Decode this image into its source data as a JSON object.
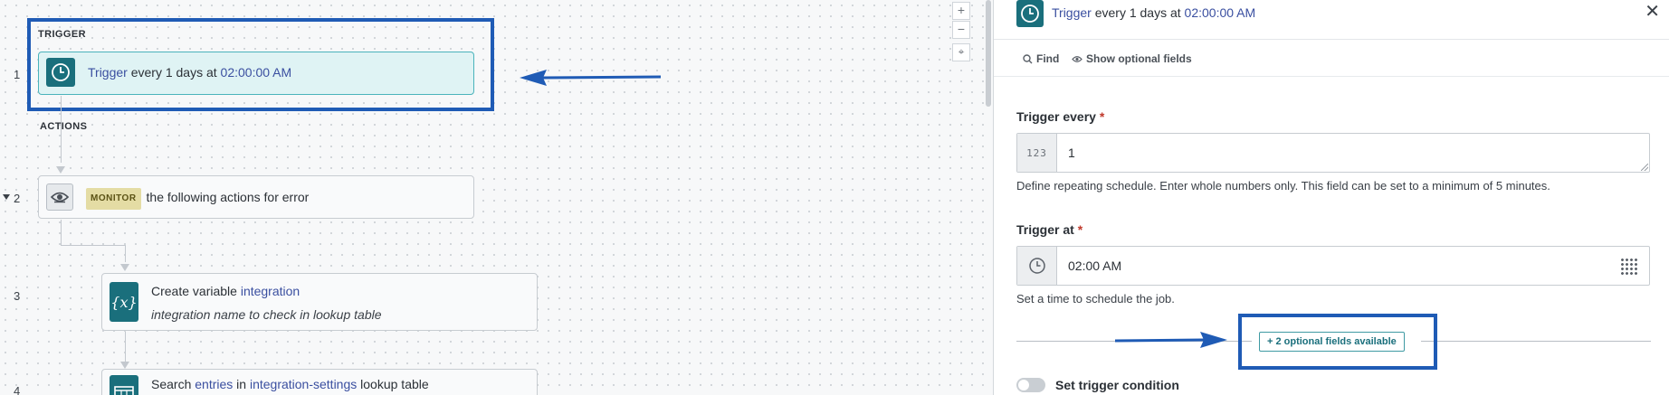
{
  "canvas": {
    "trigger_section": "TRIGGER",
    "actions_section": "ACTIONS",
    "zoom_in": "+",
    "zoom_out": "−",
    "fit": "⌖",
    "steps": [
      {
        "num": "1",
        "prefix": "Trigger",
        "text": " every 1 days at ",
        "time": "02:00:00 AM"
      },
      {
        "num": "2",
        "badge": "MONITOR",
        "text": "the following actions for error"
      },
      {
        "num": "3",
        "prefix": "Create variable ",
        "link": "integration",
        "sub": "integration name to check in lookup table"
      },
      {
        "num": "4",
        "prefix": "Search ",
        "link1": "entries",
        "mid": " in ",
        "link2": "integration-settings",
        "suffix": " lookup table"
      }
    ]
  },
  "panel": {
    "header": {
      "prefix": "Trigger",
      "text": " every 1 days at ",
      "time": "02:00:00 AM",
      "close": "✕"
    },
    "toolbar": {
      "find": "Find",
      "optional": "Show optional fields"
    },
    "trigger_every": {
      "label": "Trigger every",
      "required": "*",
      "prefix": "123",
      "value": "1",
      "help": "Define repeating schedule. Enter whole numbers only. This field can be set to a minimum of 5 minutes."
    },
    "trigger_at": {
      "label": "Trigger at",
      "required": "*",
      "value": "02:00 AM",
      "help": "Set a time to schedule the job."
    },
    "optional_fields_button": "+ 2 optional fields available",
    "trigger_condition": "Set trigger condition"
  },
  "colors": {
    "accent_teal": "#1a6f7c",
    "highlight_blue": "#1f5bb5",
    "link": "#3a4fa0",
    "badge_bg": "#e4dca4"
  }
}
